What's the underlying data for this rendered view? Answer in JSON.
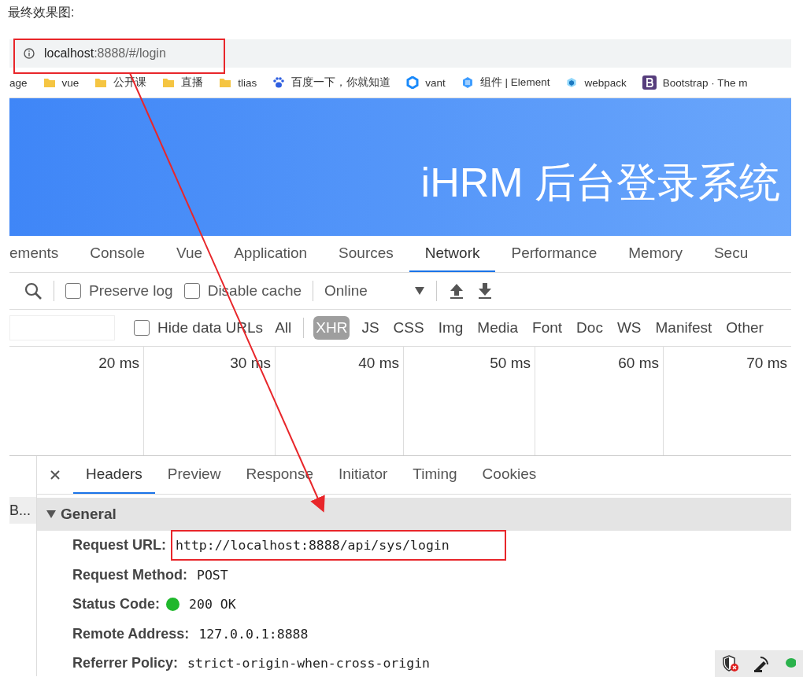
{
  "caption": "最终效果图:",
  "address": {
    "host": "localhost",
    "path": ":8888/#/login"
  },
  "bookmarks": [
    {
      "label": "age",
      "kind": "none"
    },
    {
      "label": "vue",
      "kind": "folder"
    },
    {
      "label": "公开课",
      "kind": "folder"
    },
    {
      "label": "直播",
      "kind": "folder"
    },
    {
      "label": "tlias",
      "kind": "folder"
    },
    {
      "label": "百度一下，你就知道",
      "kind": "paw"
    },
    {
      "label": "vant",
      "kind": "vant"
    },
    {
      "label": "组件 | Element",
      "kind": "element"
    },
    {
      "label": "webpack",
      "kind": "webpack"
    },
    {
      "label": "Bootstrap · The m",
      "kind": "bootstrap"
    }
  ],
  "banner": {
    "title": "iHRM 后台登录系统"
  },
  "devtools_tabs": [
    {
      "label": "ements",
      "selected": false
    },
    {
      "label": "Console",
      "selected": false
    },
    {
      "label": "Vue",
      "selected": false
    },
    {
      "label": "Application",
      "selected": false
    },
    {
      "label": "Sources",
      "selected": false
    },
    {
      "label": "Network",
      "selected": true
    },
    {
      "label": "Performance",
      "selected": false
    },
    {
      "label": "Memory",
      "selected": false
    },
    {
      "label": "Secu",
      "selected": false
    }
  ],
  "toolbar": {
    "preserve_log": {
      "label": "Preserve log",
      "checked": false
    },
    "disable_cache": {
      "label": "Disable cache",
      "checked": false
    },
    "throttle": "Online"
  },
  "filter": {
    "hide_data_urls": {
      "label": "Hide data URLs",
      "checked": false
    },
    "types": [
      {
        "label": "All",
        "selected": false
      },
      {
        "label": "XHR",
        "selected": true
      },
      {
        "label": "JS",
        "selected": false
      },
      {
        "label": "CSS",
        "selected": false
      },
      {
        "label": "Img",
        "selected": false
      },
      {
        "label": "Media",
        "selected": false
      },
      {
        "label": "Font",
        "selected": false
      },
      {
        "label": "Doc",
        "selected": false
      },
      {
        "label": "WS",
        "selected": false
      },
      {
        "label": "Manifest",
        "selected": false
      },
      {
        "label": "Other",
        "selected": false
      }
    ]
  },
  "timeline_ticks": [
    "20 ms",
    "30 ms",
    "40 ms",
    "50 ms",
    "60 ms",
    "70 ms"
  ],
  "request_list": [
    "B..."
  ],
  "detail_tabs": [
    {
      "label": "Headers",
      "selected": true
    },
    {
      "label": "Preview",
      "selected": false
    },
    {
      "label": "Response",
      "selected": false
    },
    {
      "label": "Initiator",
      "selected": false
    },
    {
      "label": "Timing",
      "selected": false
    },
    {
      "label": "Cookies",
      "selected": false
    }
  ],
  "general": {
    "title": "General",
    "expanded": true,
    "rows": [
      {
        "label": "Request URL:",
        "value": "http://localhost:8888/api/sys/login",
        "kind": "text",
        "highlighted": true
      },
      {
        "label": "Request Method:",
        "value": "POST",
        "kind": "text",
        "highlighted": false
      },
      {
        "label": "Status Code:",
        "value": "200 OK",
        "kind": "status",
        "color": "#1fb82c",
        "highlighted": false
      },
      {
        "label": "Remote Address:",
        "value": "127.0.0.1:8888",
        "kind": "text",
        "highlighted": false
      },
      {
        "label": "Referrer Policy:",
        "value": "strict-origin-when-cross-origin",
        "kind": "text",
        "highlighted": false
      }
    ]
  }
}
